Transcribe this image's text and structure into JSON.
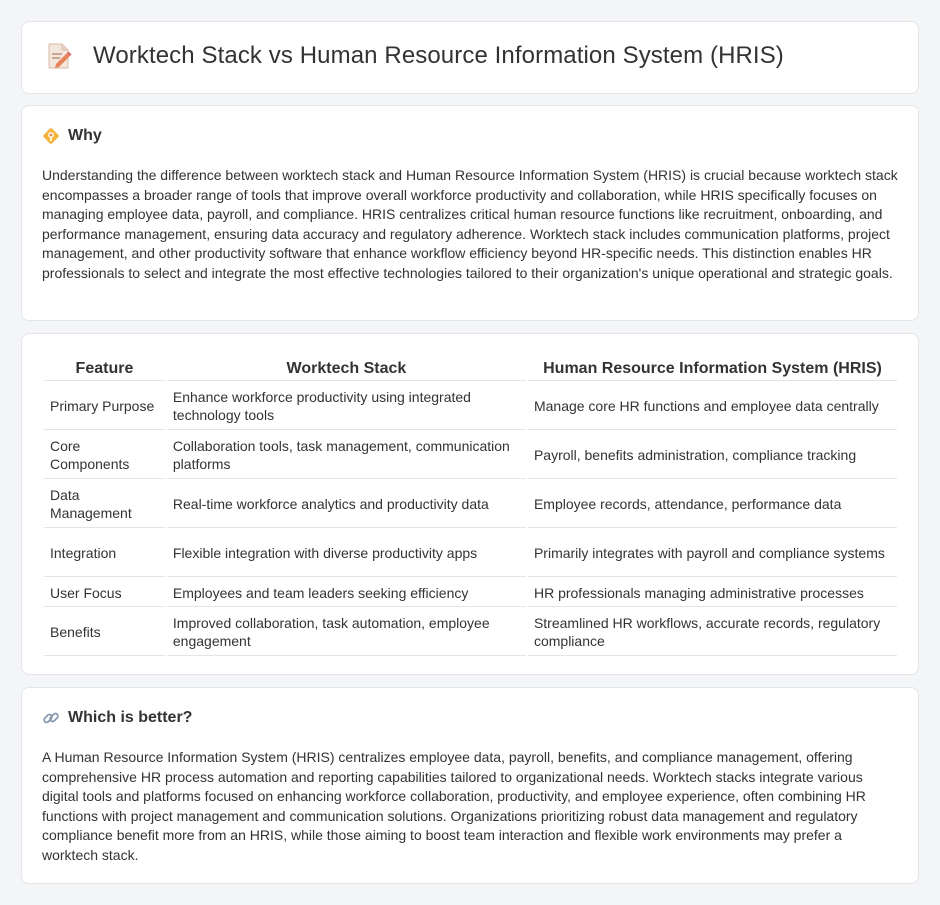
{
  "header": {
    "title": "Worktech Stack vs Human Resource Information System (HRIS)",
    "icon": "document-edit-icon"
  },
  "why": {
    "title": "Why",
    "icon": "lightbulb-icon",
    "text": "Understanding the difference between worktech stack and Human Resource Information System (HRIS) is crucial because worktech stack encompasses a broader range of tools that improve overall workforce productivity and collaboration, while HRIS specifically focuses on managing employee data, payroll, and compliance. HRIS centralizes critical human resource functions like recruitment, onboarding, and performance management, ensuring data accuracy and regulatory adherence. Worktech stack includes communication platforms, project management, and other productivity software that enhance workflow efficiency beyond HR-specific needs. This distinction enables HR professionals to select and integrate the most effective technologies tailored to their organization's unique operational and strategic goals."
  },
  "table": {
    "headers": [
      "Feature",
      "Worktech Stack",
      "Human Resource Information System (HRIS)"
    ],
    "rows": [
      [
        "Primary Purpose",
        "Enhance workforce productivity using integrated technology tools",
        "Manage core HR functions and employee data centrally"
      ],
      [
        "Core Components",
        "Collaboration tools, task management, communication platforms",
        "Payroll, benefits administration, compliance tracking"
      ],
      [
        "Data Management",
        "Real-time workforce analytics and productivity data",
        "Employee records, attendance, performance data"
      ],
      [
        "Integration",
        "Flexible integration with diverse productivity apps",
        "Primarily integrates with payroll and compliance systems"
      ],
      [
        "User Focus",
        "Employees and team leaders seeking efficiency",
        "HR professionals managing administrative processes"
      ],
      [
        "Benefits",
        "Improved collaboration, task automation, employee engagement",
        "Streamlined HR workflows, accurate records, regulatory compliance"
      ]
    ]
  },
  "better": {
    "title": "Which is better?",
    "icon": "link-icon",
    "text": "A Human Resource Information System (HRIS) centralizes employee data, payroll, benefits, and compliance management, offering comprehensive HR process automation and reporting capabilities tailored to organizational needs. Worktech stacks integrate various digital tools and platforms focused on enhancing workforce collaboration, productivity, and employee experience, often combining HR functions with project management and communication solutions. Organizations prioritizing robust data management and regulatory compliance benefit more from an HRIS, while those aiming to boost team interaction and flexible work environments may prefer a worktech stack."
  },
  "colors": {
    "background": "#f4f5f7",
    "card": "#ffffff",
    "border": "#e3e5e8",
    "text": "#333333",
    "icon_accent": "#e8845a"
  }
}
